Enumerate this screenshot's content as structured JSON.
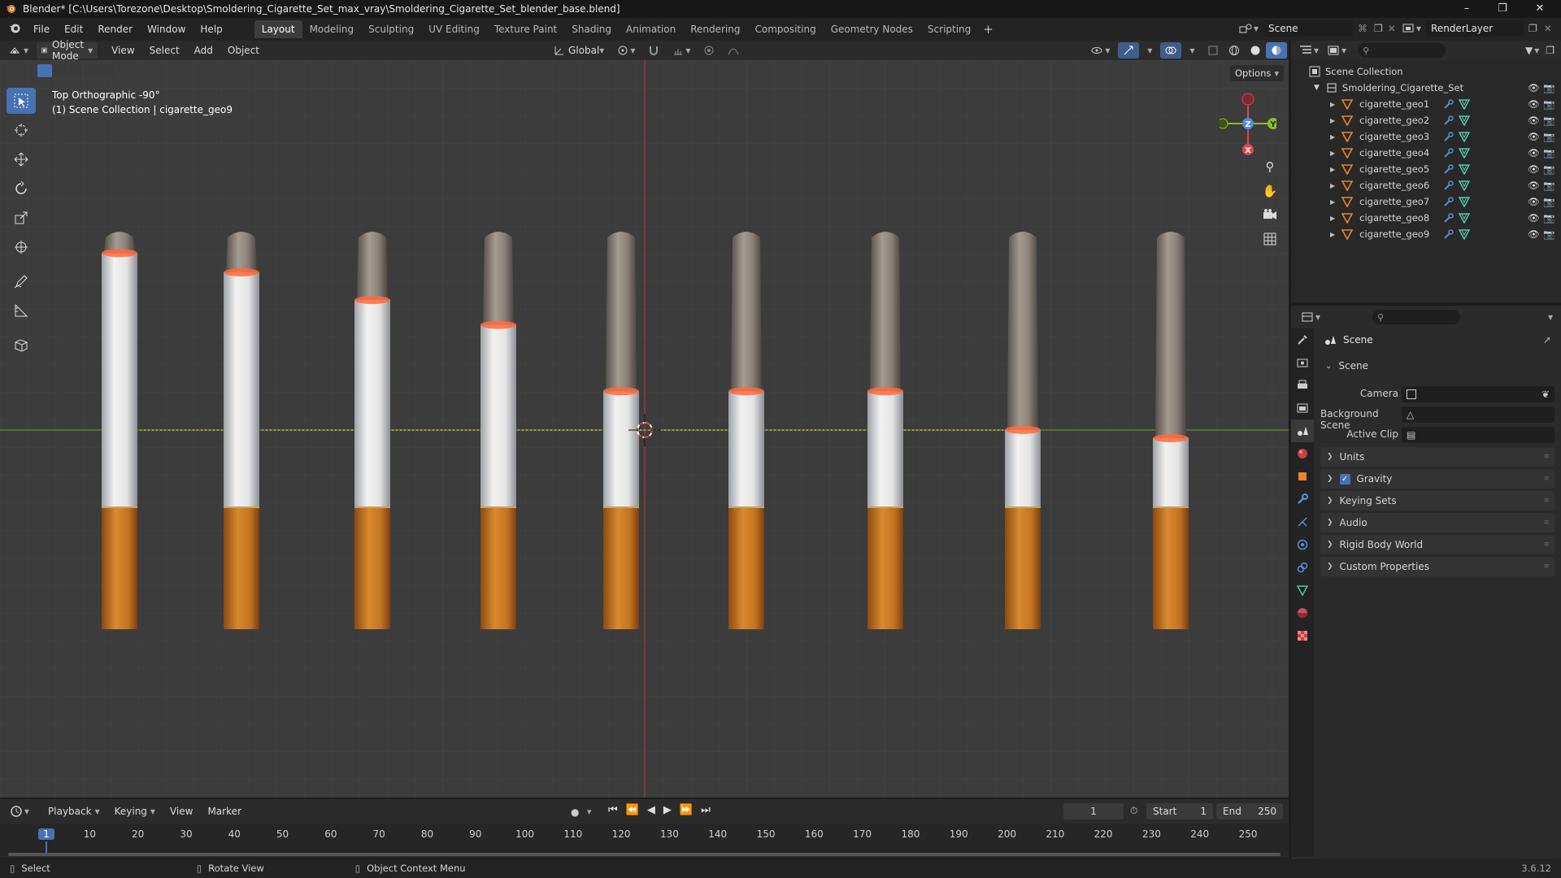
{
  "window": {
    "title": "Blender* [C:\\Users\\Torezone\\Desktop\\Smoldering_Cigarette_Set_max_vray\\Smoldering_Cigarette_Set_blender_base.blend]"
  },
  "menus": [
    "File",
    "Edit",
    "Render",
    "Window",
    "Help"
  ],
  "workspaces": [
    {
      "label": "Layout",
      "active": true
    },
    {
      "label": "Modeling"
    },
    {
      "label": "Sculpting"
    },
    {
      "label": "UV Editing"
    },
    {
      "label": "Texture Paint"
    },
    {
      "label": "Shading"
    },
    {
      "label": "Animation"
    },
    {
      "label": "Rendering"
    },
    {
      "label": "Compositing"
    },
    {
      "label": "Geometry Nodes"
    },
    {
      "label": "Scripting"
    }
  ],
  "scene_selector": {
    "value": "Scene"
  },
  "renderlayer_selector": {
    "value": "RenderLayer"
  },
  "viewport_header": {
    "mode": "Object Mode",
    "menus": [
      "View",
      "Select",
      "Add",
      "Object"
    ],
    "transform_orientation": "Global",
    "options_label": "Options"
  },
  "viewport": {
    "view_name": "Top Orthographic -90°",
    "collection_info": "(1) Scene Collection | cigarette_geo9",
    "gizmo_axes": [
      "Z",
      "Y",
      "X"
    ],
    "colors": {
      "axis_x": "#e0434f",
      "axis_y": "#8cbe27",
      "axis_z": "#4b8ce0",
      "filter": "#ff6a3c"
    },
    "cigarettes": [
      {
        "name": "cigarette_geo1",
        "ash_fraction": 0.08
      },
      {
        "name": "cigarette_geo2",
        "ash_fraction": 0.15
      },
      {
        "name": "cigarette_geo3",
        "ash_fraction": 0.25
      },
      {
        "name": "cigarette_geo4",
        "ash_fraction": 0.34
      },
      {
        "name": "cigarette_geo5",
        "ash_fraction": 0.58
      },
      {
        "name": "cigarette_geo6",
        "ash_fraction": 0.58
      },
      {
        "name": "cigarette_geo7",
        "ash_fraction": 0.58
      },
      {
        "name": "cigarette_geo8",
        "ash_fraction": 0.72
      },
      {
        "name": "cigarette_geo9",
        "ash_fraction": 0.75
      }
    ]
  },
  "outliner": {
    "root": "Scene Collection",
    "collection": "Smoldering_Cigarette_Set",
    "objects": [
      "cigarette_geo1",
      "cigarette_geo2",
      "cigarette_geo3",
      "cigarette_geo4",
      "cigarette_geo5",
      "cigarette_geo6",
      "cigarette_geo7",
      "cigarette_geo8",
      "cigarette_geo9"
    ]
  },
  "properties": {
    "context_title": "Scene",
    "section": "Scene",
    "fields": [
      {
        "label": "Camera"
      },
      {
        "label": "Background Scene"
      },
      {
        "label": "Active Clip"
      }
    ],
    "panels": [
      {
        "label": "Units",
        "checkbox": false
      },
      {
        "label": "Gravity",
        "checkbox": true
      },
      {
        "label": "Keying Sets",
        "checkbox": false
      },
      {
        "label": "Audio",
        "checkbox": false
      },
      {
        "label": "Rigid Body World",
        "checkbox": false
      },
      {
        "label": "Custom Properties",
        "checkbox": false
      }
    ]
  },
  "timeline": {
    "menus": [
      "Playback",
      "Keying",
      "View",
      "Marker"
    ],
    "current_frame": "1",
    "start_label": "Start",
    "start": "1",
    "end_label": "End",
    "end": "250",
    "ruler": [
      "1",
      "10",
      "20",
      "30",
      "40",
      "50",
      "60",
      "70",
      "80",
      "90",
      "100",
      "110",
      "120",
      "130",
      "140",
      "150",
      "160",
      "170",
      "180",
      "190",
      "200",
      "210",
      "220",
      "230",
      "240",
      "250"
    ]
  },
  "statusbar": {
    "items": [
      "Select",
      "Rotate View",
      "Object Context Menu"
    ],
    "version": "3.6.12"
  }
}
